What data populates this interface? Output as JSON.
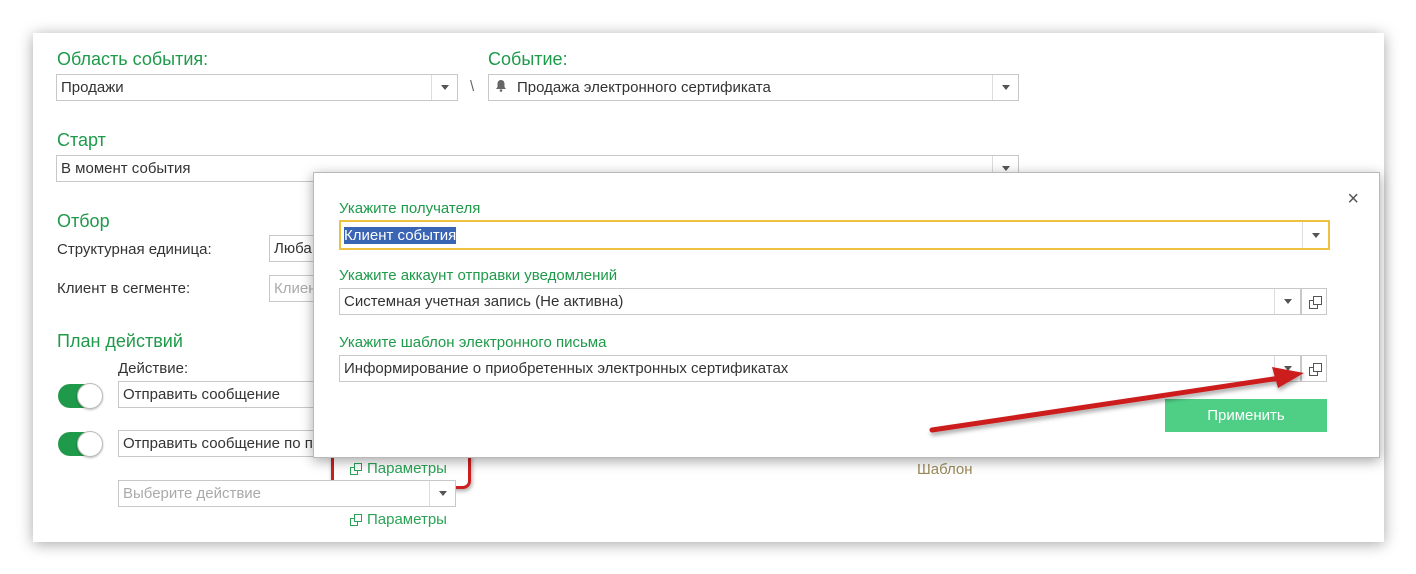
{
  "main": {
    "area_label": "Область события:",
    "area_value": "Продажи",
    "separator": "\\",
    "event_label": "Событие:",
    "event_value": "Продажа электронного сертификата",
    "start_label": "Старт",
    "start_value": "В момент события",
    "filter_label": "Отбор",
    "struct_unit_label": "Структурная единица:",
    "struct_unit_value": "Люба",
    "client_segment_label": "Клиент в сегменте:",
    "client_segment_placeholder": "Клиен",
    "plan_label": "План действий",
    "action_label": "Действие:",
    "actions": [
      {
        "value": "Отправить сообщение",
        "enabled": true
      },
      {
        "value": "Отправить сообщение по п",
        "enabled": true
      }
    ],
    "choose_action_placeholder": "Выберите действие",
    "params_link": "Параметры",
    "params_link_2": "Параметры",
    "template_label": "Шаблон"
  },
  "dialog": {
    "recipient_label": "Укажите получателя",
    "recipient_value": "Клиент события",
    "account_label": "Укажите аккаунт отправки уведомлений",
    "account_value": "Системная учетная запись (Не активна)",
    "template_label": "Укажите шаблон электронного письма",
    "template_value": "Информирование о приобретенных электронных сертификатах",
    "apply_button": "Применить",
    "close_glyph": "×"
  },
  "colors": {
    "accent_green": "#1e9a4a",
    "apply_button": "#4fcf86",
    "annotation_red": "#cc1f1f",
    "focus_border": "#f0c040"
  }
}
